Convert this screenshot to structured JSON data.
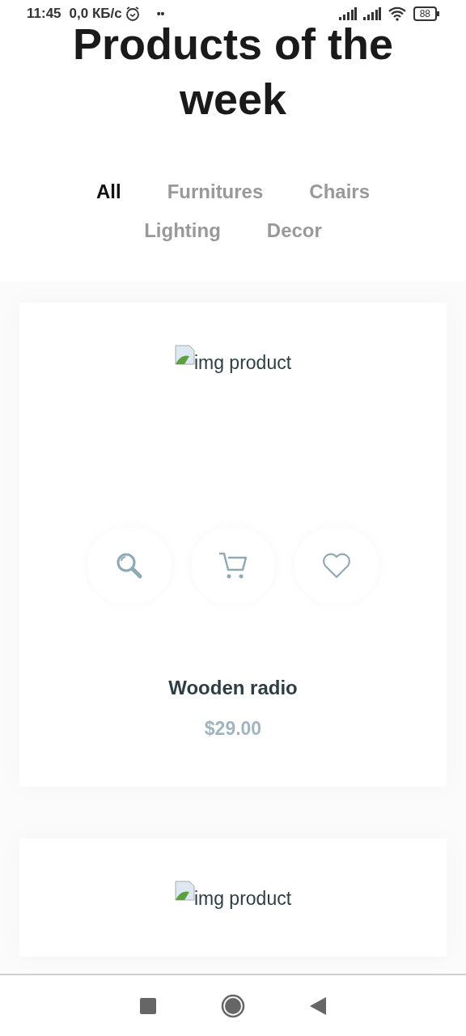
{
  "status_bar": {
    "time": "11:45",
    "speed": "0,0 КБ/с",
    "dots": "••",
    "battery": "88"
  },
  "heading": "Products of the week",
  "tabs": [
    {
      "label": "All",
      "selected": true
    },
    {
      "label": "Furnitures",
      "selected": false
    },
    {
      "label": "Chairs",
      "selected": false
    },
    {
      "label": "Lighting",
      "selected": false
    },
    {
      "label": "Decor",
      "selected": false
    }
  ],
  "products": [
    {
      "image_alt": "img product",
      "actions": [
        {
          "kind": "search"
        },
        {
          "kind": "cart"
        },
        {
          "kind": "heart"
        }
      ],
      "name": "Wooden radio",
      "price": "$29.00"
    },
    {
      "image_alt": "img product"
    }
  ]
}
